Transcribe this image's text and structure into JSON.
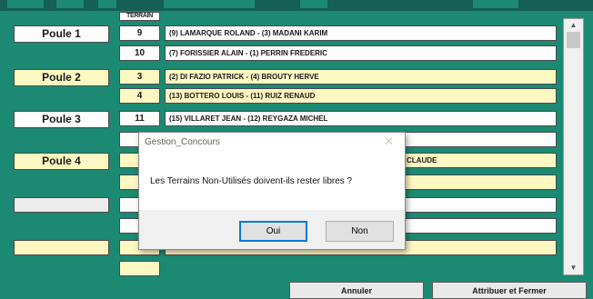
{
  "header": {
    "terrain_label": "TERRAIN"
  },
  "rows": [
    {
      "poule": "Poule 1",
      "terrain": "9",
      "match": "(9) LAMARQUE ROLAND - (3) MADANI KARIM"
    },
    {
      "poule": "",
      "terrain": "10",
      "match": "(7) FORISSIER ALAIN - (1) PERRIN FREDERIC"
    },
    {
      "poule": "Poule 2",
      "terrain": "3",
      "match": "(2) DI FAZIO PATRICK - (4) BROUTY HERVE"
    },
    {
      "poule": "",
      "terrain": "4",
      "match": "(13) BOTTERO LOUIS - (11) RUIZ RENAUD"
    },
    {
      "poule": "Poule 3",
      "terrain": "11",
      "match": "(15) VILLARET JEAN - (12) REYGAZA MICHEL"
    },
    {
      "poule": "",
      "terrain": "",
      "match": ""
    },
    {
      "poule": "Poule 4",
      "terrain": "",
      "match": "CLAUDE"
    },
    {
      "poule": "",
      "terrain": "",
      "match": ""
    },
    {
      "poule": "",
      "terrain": "",
      "match": ""
    },
    {
      "poule": "",
      "terrain": "",
      "match": ""
    },
    {
      "poule": "",
      "terrain": "",
      "match": ""
    },
    {
      "poule": "",
      "terrain": "",
      "match": ""
    }
  ],
  "buttons": {
    "cancel": "Annuler",
    "assign_close": "Attribuer et Fermer"
  },
  "dialog": {
    "title": "Gestion_Concours",
    "message": "Les Terrains Non-Utilisés doivent-ils rester libres ?",
    "yes": "Oui",
    "no": "Non",
    "close_glyph": "✕"
  },
  "scrollbar": {
    "up_glyph": "▲",
    "down_glyph": "▼"
  },
  "colors": {
    "background": "#1c8a72",
    "row_light": "#fdfdfd",
    "row_cream": "#fdf7c2",
    "dialog_focus": "#0078d7"
  }
}
